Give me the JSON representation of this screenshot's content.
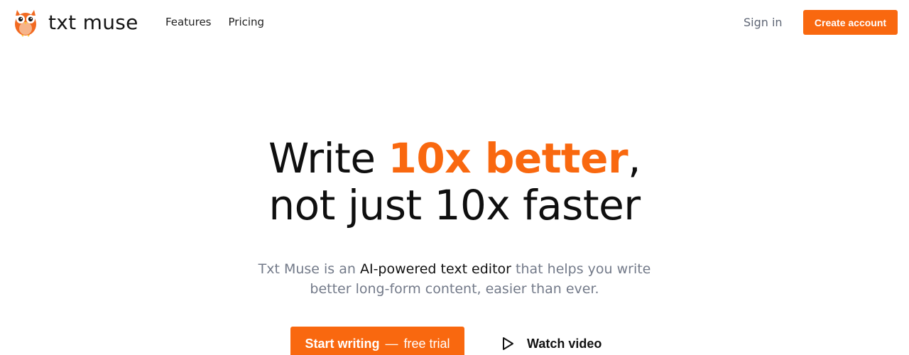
{
  "brand": {
    "name": "txt muse",
    "logo_icon": "owl-icon",
    "accent_color": "#f9680f"
  },
  "nav": {
    "items": [
      {
        "label": "Features"
      },
      {
        "label": "Pricing"
      }
    ]
  },
  "auth": {
    "signin_label": "Sign in",
    "create_label": "Create account"
  },
  "hero": {
    "headline_pre": "Write ",
    "headline_accent": "10x better",
    "headline_post": ",",
    "headline_line2": "not just 10x faster",
    "subtext_pre": "Txt Muse is an ",
    "subtext_strong": "AI-powered text editor",
    "subtext_post": " that helps you write",
    "subtext_line2": "better long-form content, easier than ever.",
    "cta_main": "Start writing",
    "cta_dash": "—",
    "cta_secondary": "free trial",
    "watch_label": "Watch video",
    "watch_icon": "play-icon"
  }
}
